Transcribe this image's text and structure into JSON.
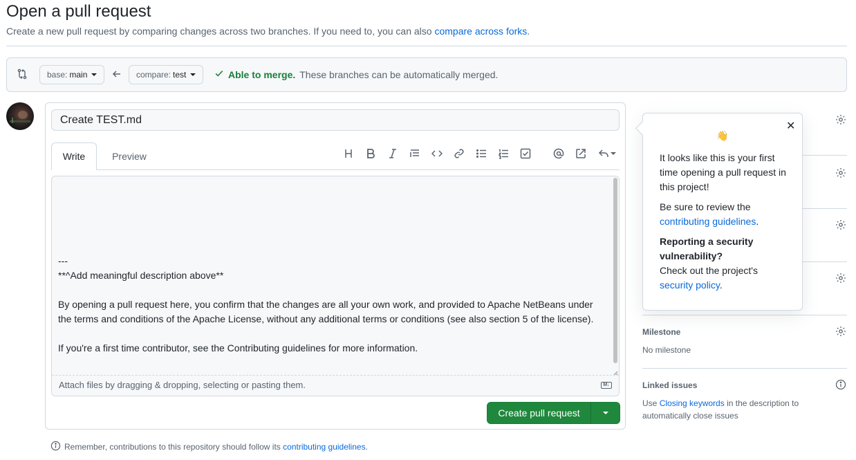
{
  "page": {
    "title": "Open a pull request",
    "subtitle_prefix": "Create a new pull request by comparing changes across two branches. If you need to, you can also ",
    "subtitle_link": "compare across forks",
    "subtitle_suffix": "."
  },
  "compare": {
    "base_label": "base:",
    "base_value": "main",
    "compare_label": "compare:",
    "compare_value": "test",
    "merge_ok": "Able to merge.",
    "merge_msg": "These branches can be automatically merged."
  },
  "editor": {
    "title_value": "Create TEST.md",
    "tabs": {
      "write": "Write",
      "preview": "Preview"
    },
    "toolbar": [
      "heading-icon",
      "bold-icon",
      "italic-icon",
      "quote-icon",
      "code-icon",
      "link-icon",
      "unordered-list-icon",
      "ordered-list-icon",
      "task-list-icon",
      "mention-icon",
      "reference-icon",
      "reply-icon"
    ],
    "body": "---\n**^Add meaningful description above**\n\nBy opening a pull request here, you confirm that the changes are all your own work, and provided to Apache NetBeans under the terms and conditions of the Apache License, without any additional terms or conditions (see also section 5 of the license).\n\nIf you're a first time contributor, see the Contributing guidelines for more information.",
    "attach_text": "Attach files by dragging & dropping, selecting or pasting them.",
    "md_badge": "M↓",
    "create_button": "Create pull request"
  },
  "footer": {
    "note_prefix": "Remember, contributions to this repository should follow its ",
    "note_link": "contributing guidelines",
    "note_suffix": "."
  },
  "popover": {
    "wave": "👋",
    "p1": "It looks like this is your first time opening a pull request in this project!",
    "p2_prefix": "Be sure to review the ",
    "p2_link": "contributing guidelines",
    "p2_suffix": ".",
    "p3_bold": "Reporting a security vulnerability?",
    "p3_text": "Check out the project's ",
    "p3_link": "security policy",
    "p3_suffix": "."
  },
  "sidebar": {
    "milestone_heading": "Milestone",
    "milestone_value": "No milestone",
    "linked_heading": "Linked issues",
    "linked_prefix": "Use ",
    "linked_link": "Closing keywords",
    "linked_suffix": " in the description to automatically close issues"
  },
  "colors": {
    "accent_link": "#0969da",
    "merge_green": "#1a7f37",
    "create_button_bg": "#1f883d"
  }
}
